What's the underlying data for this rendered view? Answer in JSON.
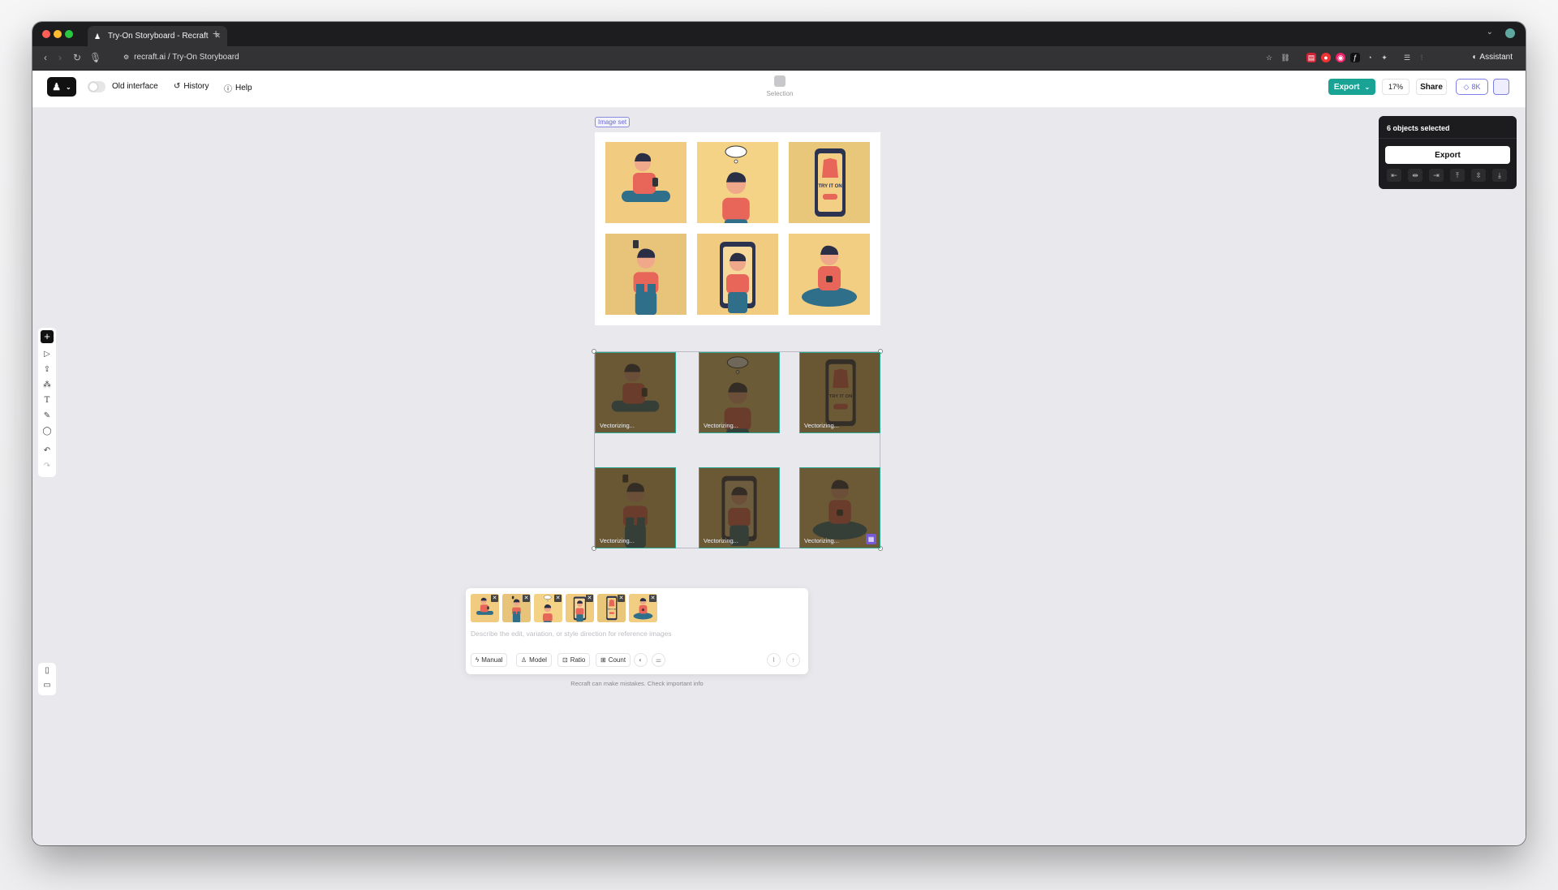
{
  "browser": {
    "tab_title": "Try-On Storyboard - Recraft",
    "url": "recraft.ai / Try-On Storyboard",
    "assistant_label": "Assistant"
  },
  "header": {
    "old_interface_label": "Old interface",
    "history_label": "History",
    "help_label": "Help",
    "selection_label": "Selection",
    "export_label": "Export",
    "zoom_value": "17%",
    "share_label": "Share",
    "credits_value": "8K"
  },
  "canvas": {
    "image_set_tag": "Image set",
    "images": [
      {
        "name": "man-sitting-phone",
        "bg": "#f1cc80"
      },
      {
        "name": "man-thinking",
        "bg": "#f4d386"
      },
      {
        "name": "phone-try-it-on",
        "bg": "#e9c77a",
        "text": "TRY IT ON"
      },
      {
        "name": "man-selfie",
        "bg": "#e8c47b"
      },
      {
        "name": "man-in-phone-frame",
        "bg": "#f1cc80"
      },
      {
        "name": "man-cross-legged-phone",
        "bg": "#f2ce83"
      }
    ],
    "vectorizing": [
      {
        "label": "Vectorizing..."
      },
      {
        "label": "Vectorizing..."
      },
      {
        "label": "Vectorizing..."
      },
      {
        "label": "Vectorizing..."
      },
      {
        "label": "Vectorizing..."
      },
      {
        "label": "Vectorizing..."
      }
    ]
  },
  "selection_panel": {
    "title": "6 objects selected",
    "export_label": "Export",
    "align_icons": [
      "align-left-icon",
      "align-center-horizontal-icon",
      "align-right-icon",
      "align-top-icon",
      "align-middle-vertical-icon",
      "align-bottom-icon"
    ]
  },
  "prompt": {
    "placeholder": "Describe the edit, variation, or style direction for reference images",
    "manual_label": "Manual",
    "model_label": "Model",
    "ratio_label": "Ratio",
    "count_label": "Count",
    "disclaimer": "Recraft can make mistakes. Check important info"
  },
  "colors": {
    "accent_teal": "#18a394",
    "accent_purple": "#7f7fe8",
    "skin": "#f0a88a",
    "shirt": "#e8655a",
    "pants": "#2f6f8a",
    "hair": "#2a2f45"
  }
}
